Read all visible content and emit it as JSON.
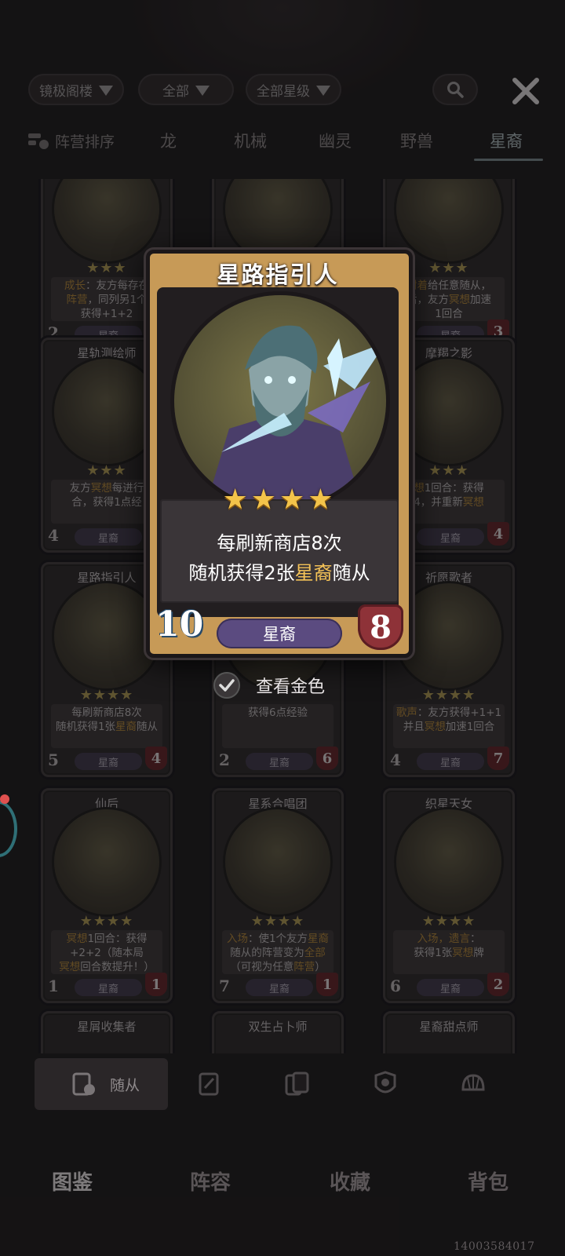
{
  "filters": {
    "location": "镜极阁楼",
    "category": "全部",
    "star_level": "全部星级"
  },
  "tabs": {
    "sort": "阵营排序",
    "items": [
      "龙",
      "机械",
      "幽灵",
      "野兽",
      "星裔"
    ],
    "active": "星裔"
  },
  "cards": [
    {
      "title": "",
      "stars": "★★★",
      "desc_html": "<span class='hl'>成长</span>：友方每存在<br><span class='hl'>阵营</span>，同列另1个<br>获得+1+2",
      "tribe": "星裔",
      "atk": "2",
      "hp": ""
    },
    {
      "title": "",
      "stars": "★★★",
      "desc_html": "",
      "tribe": "",
      "atk": "",
      "hp": ""
    },
    {
      "title": "",
      "stars": "★★★",
      "desc_html": "<span class='hl'>附着</span>给任意随从，<br>后，友方<span class='hl'>冥想</span>加速<br>1回合",
      "tribe": "星裔",
      "atk": "",
      "hp": "3"
    },
    {
      "title": "星轨测绘师",
      "stars": "★★★",
      "desc_html": "友方<span class='hl'>冥想</span>每进行<br>合，获得1点经",
      "tribe": "星裔",
      "atk": "4",
      "hp": ""
    },
    {
      "title": "",
      "stars": "",
      "desc_html": "",
      "tribe": "",
      "atk": "",
      "hp": ""
    },
    {
      "title": "摩羯之影",
      "stars": "★★★",
      "desc_html": "<span class='hl'>想</span>1回合：获得<br>4，并重新<span class='hl'>冥想</span>",
      "tribe": "星裔",
      "atk": "",
      "hp": "4"
    },
    {
      "title": "星路指引人",
      "stars": "★★★★",
      "desc_html": "每刷新商店8次<br>随机获得1张<span class='hl'>星裔</span>随从",
      "tribe": "星裔",
      "atk": "5",
      "hp": "4"
    },
    {
      "title": "",
      "stars": "",
      "desc_html": "获得6点经验",
      "tribe": "星裔",
      "atk": "2",
      "hp": "6"
    },
    {
      "title": "祈愿歌者",
      "stars": "★★★★",
      "desc_html": "<span class='hl'>歌声</span>：友方获得+1+1<br>并且<span class='hl'>冥想</span>加速1回合",
      "tribe": "星裔",
      "atk": "4",
      "hp": "7"
    },
    {
      "title": "仙后",
      "stars": "★★★★",
      "desc_html": "<span class='hl'>冥想</span>1回合：获得<br>+2+2（随本局<br><span class='hl'>冥想</span>回合数提升！）",
      "tribe": "星裔",
      "atk": "1",
      "hp": "1"
    },
    {
      "title": "星系合唱团",
      "stars": "★★★★",
      "desc_html": "<span class='hl'>入场</span>：使1个友方<span class='hl'>星裔</span><br>随从的阵营变为<span class='hl'>全部</span><br>（可视为任意<span class='hl'>阵营</span>）",
      "tribe": "星裔",
      "atk": "7",
      "hp": "1"
    },
    {
      "title": "织星天女",
      "stars": "★★★★",
      "desc_html": "<span class='hl'>入场，遗言</span>：<br>获得1张<span class='hl'>冥想</span>牌",
      "tribe": "星裔",
      "atk": "6",
      "hp": "2"
    },
    {
      "title": "星屑收集者",
      "stars": "",
      "desc_html": "",
      "tribe": "",
      "atk": "",
      "hp": ""
    },
    {
      "title": "双生占卜师",
      "stars": "",
      "desc_html": "",
      "tribe": "",
      "atk": "",
      "hp": ""
    },
    {
      "title": "星裔甜点师",
      "stars": "",
      "desc_html": "",
      "tribe": "",
      "atk": "",
      "hp": ""
    }
  ],
  "popup": {
    "name": "星路指引人",
    "stars": "★★★★",
    "desc_line1": "每刷新商店8次",
    "desc_line2_pre": "随机获得2张",
    "desc_line2_hl": "星裔",
    "desc_line2_post": "随从",
    "atk": "10",
    "tribe": "星裔",
    "hp": "8"
  },
  "gold_toggle": "查看金色",
  "subtabs": {
    "active_label": "随从"
  },
  "bottom_nav": {
    "items": [
      "图鉴",
      "阵容",
      "收藏",
      "背包"
    ],
    "active": "图鉴"
  },
  "version": "14003584017",
  "colors": {
    "background": "#1d1a1c",
    "popup_frame": "#c79a57",
    "highlight": "#f4c257",
    "tribe_pill": "#5b4b80",
    "hp_red": "#8e3238"
  }
}
